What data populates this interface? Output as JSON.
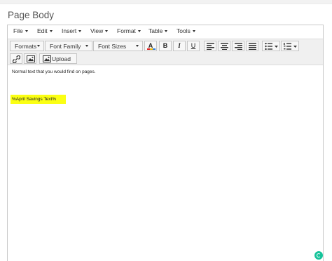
{
  "section": {
    "label": "Page Body"
  },
  "menubar": {
    "items": [
      "File",
      "Edit",
      "Insert",
      "View",
      "Format",
      "Table",
      "Tools"
    ]
  },
  "toolbar": {
    "formats_label": "Formats",
    "font_family_label": "Font Family",
    "font_sizes_label": "Font Sizes",
    "upload_label": "Upload",
    "icons": [
      "text-color-icon",
      "bold-icon",
      "italic-icon",
      "underline-icon",
      "align-left-icon",
      "align-center-icon",
      "align-right-icon",
      "align-justify-icon",
      "bullet-list-icon",
      "numbered-list-icon",
      "link-icon",
      "image-icon",
      "upload-icon"
    ],
    "bold_glyph": "B",
    "italic_glyph": "I",
    "underline_glyph": "U",
    "text_color_glyph": "A"
  },
  "content": {
    "paragraph": "Normal text that you would find on pages.",
    "highlighted": "%April Savings Text%"
  },
  "colors": {
    "highlight": "#fbff13",
    "grammarly": "#15c39a"
  }
}
